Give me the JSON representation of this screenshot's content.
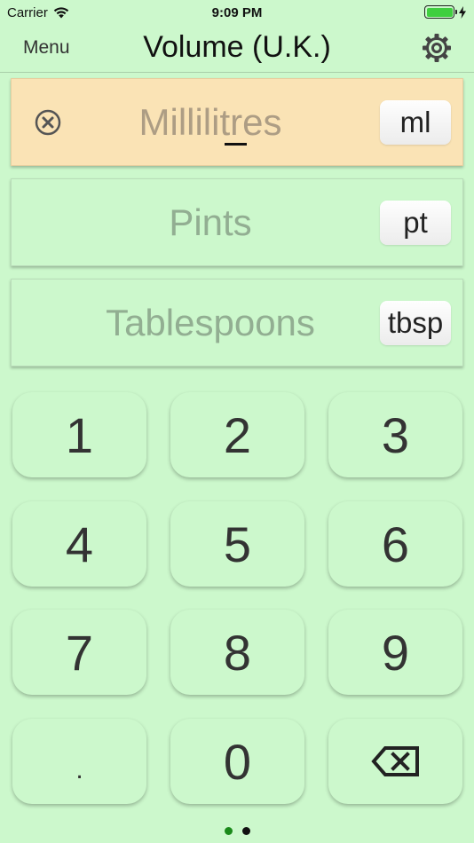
{
  "status": {
    "carrier": "Carrier",
    "time": "9:09 PM"
  },
  "nav": {
    "menu_label": "Menu",
    "title": "Volume (U.K.)"
  },
  "units": [
    {
      "label": "Millilitres",
      "abbr": "ml",
      "active": true
    },
    {
      "label": "Pints",
      "abbr": "pt",
      "active": false
    },
    {
      "label": "Tablespoons",
      "abbr": "tbsp",
      "active": false
    }
  ],
  "keypad": {
    "keys": [
      "1",
      "2",
      "3",
      "4",
      "5",
      "6",
      "7",
      "8",
      "9",
      ".",
      "0"
    ]
  },
  "pager": {
    "pages": 2,
    "current": 1
  },
  "colors": {
    "background": "#ccf8cc",
    "active_row": "#fae3b5",
    "dot_active": "#1a8a1a",
    "dot_inactive": "#111111"
  }
}
